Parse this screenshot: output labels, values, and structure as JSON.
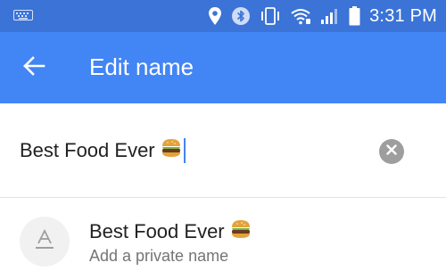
{
  "status_bar": {
    "time": "3:31 PM",
    "icons": [
      "keyboard-icon",
      "location-pin-icon",
      "bluetooth-icon",
      "vibrate-icon",
      "wifi-icon",
      "signal-icon",
      "battery-icon"
    ]
  },
  "app_bar": {
    "back_icon": "arrow-back-icon",
    "title": "Edit name"
  },
  "name_input": {
    "value": "Best Food Ever",
    "emoji": "hamburger-emoji",
    "clear_icon": "clear-icon"
  },
  "suggestion": {
    "name": "Best Food Ever",
    "subtitle": "Add a private name",
    "emoji": "hamburger-emoji",
    "avatar_icon": "text-format-icon"
  },
  "colors": {
    "status_bar": "#3b73d6",
    "app_bar": "#4285f4",
    "accent": "#4285f4"
  }
}
